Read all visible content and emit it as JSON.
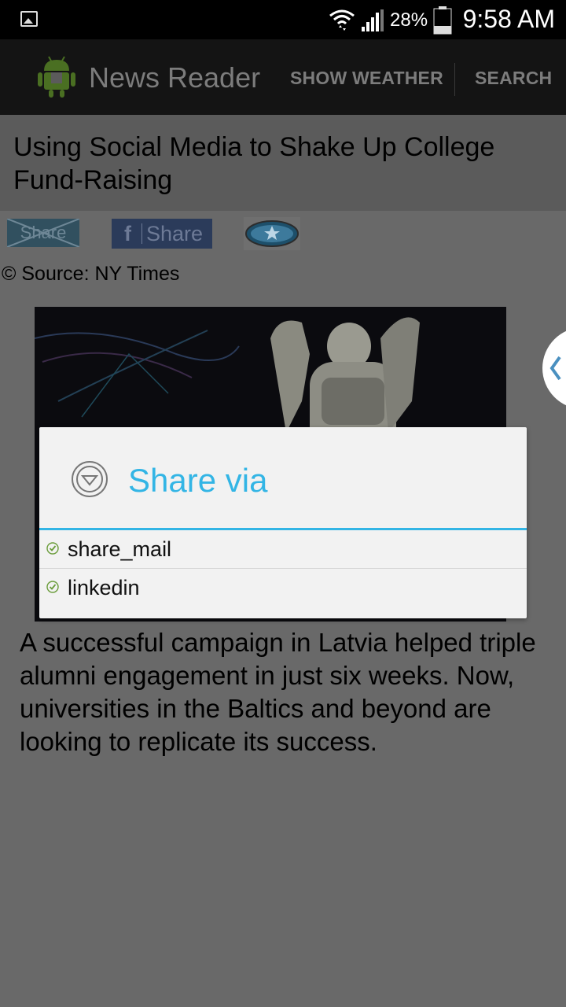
{
  "status_bar": {
    "battery_percent": "28%",
    "time": "9:58 AM",
    "icons": [
      "gallery-notification-icon",
      "wifi-icon",
      "signal-icon",
      "battery-icon"
    ]
  },
  "action_bar": {
    "app_title": "News Reader",
    "show_weather_label": "SHOW WEATHER",
    "search_label": "SEARCH"
  },
  "article": {
    "title": "Using Social Media to Shake Up College Fund-Raising",
    "share_x_label": "Share",
    "fb_share_label": "Share",
    "fb_letter": "f",
    "source": "© Source: NY Times",
    "body": "A successful campaign in Latvia helped triple alumni engagement in just six weeks. Now, universities in the Baltics and beyond are looking to replicate its success."
  },
  "dialog": {
    "title": "Share via",
    "items": [
      {
        "label": "share_mail"
      },
      {
        "label": "linkedin"
      }
    ]
  },
  "colors": {
    "accent": "#33b5e5",
    "dim_background": "#696969",
    "action_bar": "#141414"
  }
}
